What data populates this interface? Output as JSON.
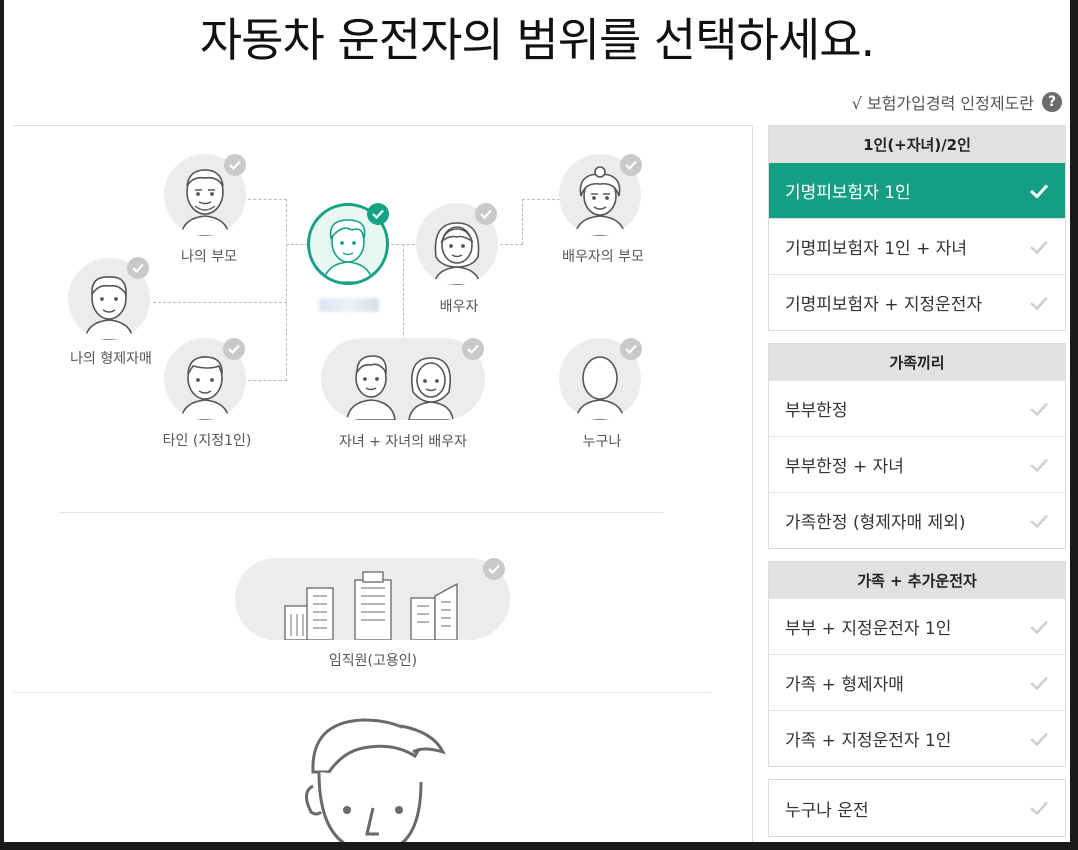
{
  "page": {
    "title": "자동차 운전자의 범위를 선택하세요.",
    "info_link": "√ 보험가입경력 인정제도란",
    "help_icon": "?"
  },
  "diagram": {
    "nodes": {
      "my_parents": "나의 부모",
      "my_siblings": "나의 형제자매",
      "other_person": "타인 (지정1인)",
      "spouse": "배우자",
      "spouse_parents": "배우자의 부모",
      "children": "자녀 + 자녀의 배우자",
      "anyone": "누구나",
      "employees": "임직원(고용인)"
    },
    "selected_node": "self",
    "accent_color": "#15a386"
  },
  "sidebar": {
    "groups": [
      {
        "header": "1인(+자녀)/2인",
        "options": [
          "기명피보험자 1인",
          "기명피보험자 1인 + 자녀",
          "기명피보험자 + 지정운전자"
        ]
      },
      {
        "header": "가족끼리",
        "options": [
          "부부한정",
          "부부한정 + 자녀",
          "가족한정 (형제자매 제외)"
        ]
      },
      {
        "header": "가족 + 추가운전자",
        "options": [
          "부부 + 지정운전자 1인",
          "가족 + 형제자매",
          "가족 + 지정운전자 1인"
        ]
      },
      {
        "header": "",
        "options": [
          "누구나 운전"
        ]
      }
    ],
    "selected_option": "기명피보험자 1인",
    "selected_color": "#149f84"
  }
}
